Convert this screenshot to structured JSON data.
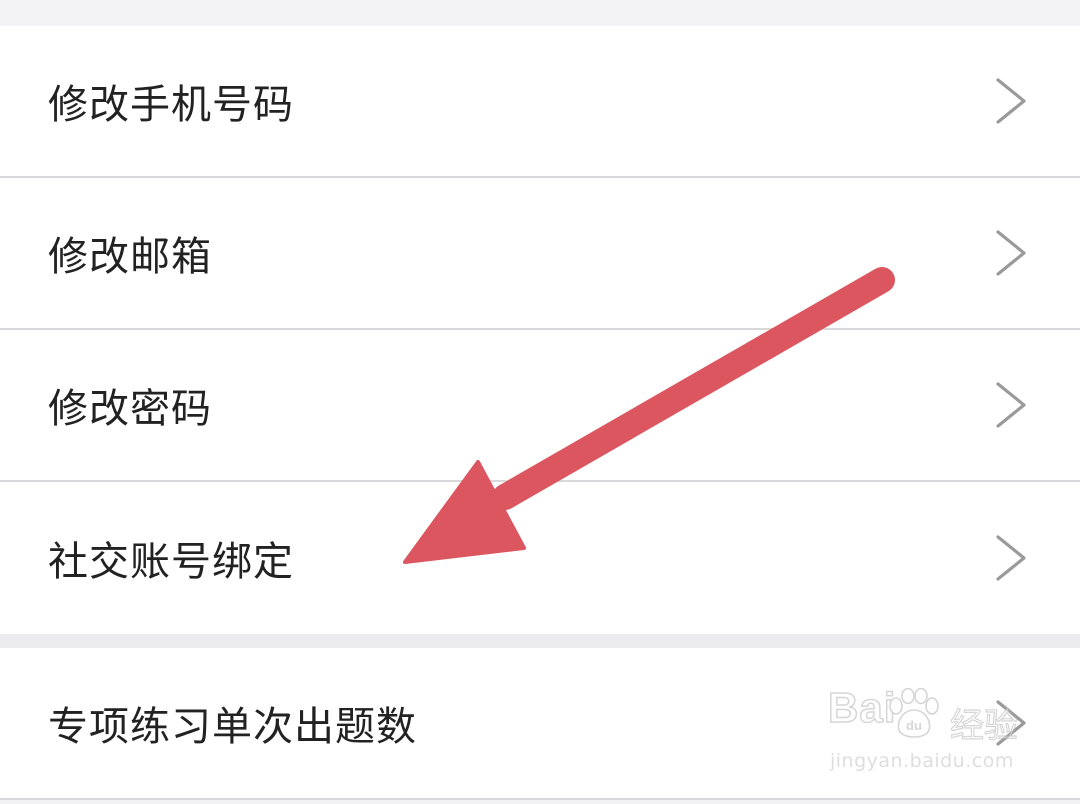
{
  "settings": {
    "group1": [
      {
        "label": "修改手机号码",
        "icon": "chevron-right-icon"
      },
      {
        "label": "修改邮箱",
        "icon": "chevron-right-icon"
      },
      {
        "label": "修改密码",
        "icon": "chevron-right-icon"
      },
      {
        "label": "社交账号绑定",
        "icon": "chevron-right-icon"
      }
    ],
    "group2": [
      {
        "label": "专项练习单次出题数",
        "icon": "chevron-right-icon"
      }
    ]
  },
  "annotation": {
    "arrow_color": "#dc5660",
    "points_to": "社交账号绑定"
  },
  "watermark": {
    "brand": "Bai",
    "brand_suffix": "du",
    "cn": "经验",
    "url": "jingyan.baidu.com"
  },
  "colors": {
    "background": "#f2f2f4",
    "row_background": "#ffffff",
    "text": "#222222",
    "divider": "#d9d9db",
    "chevron": "#9a9a9a"
  }
}
